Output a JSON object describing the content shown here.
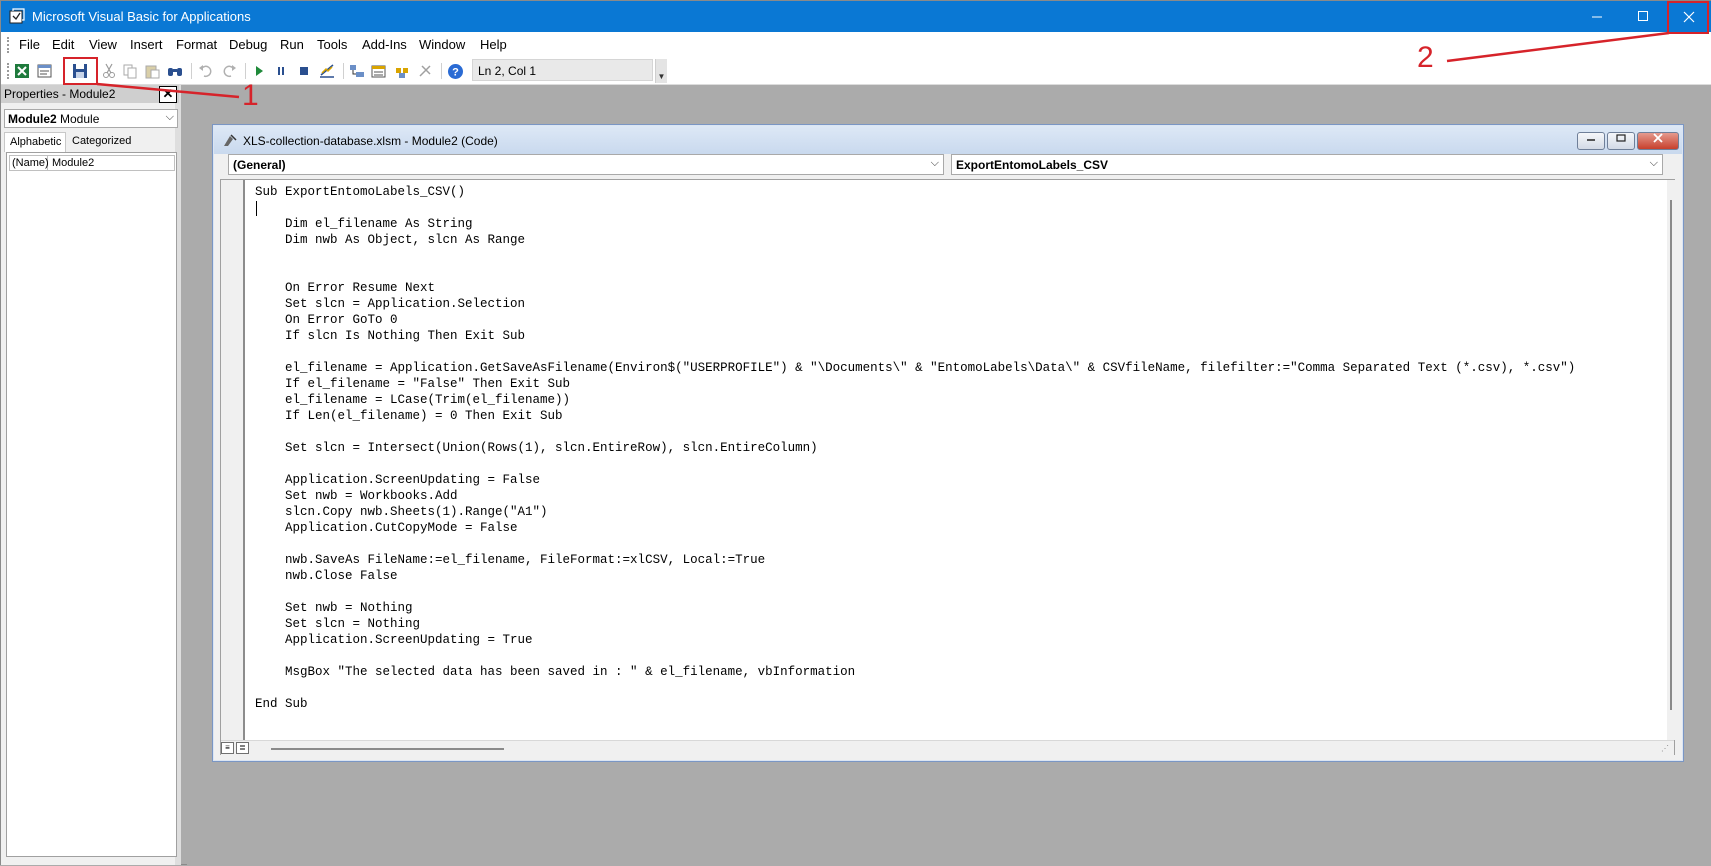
{
  "window": {
    "title": "Microsoft Visual Basic for Applications",
    "minimize_icon": "minimize-icon",
    "maximize_icon": "maximize-icon",
    "close_icon": "close-icon"
  },
  "menu": {
    "items": [
      "File",
      "Edit",
      "View",
      "Insert",
      "Format",
      "Debug",
      "Run",
      "Tools",
      "Add-Ins",
      "Window",
      "Help"
    ]
  },
  "toolbar": {
    "status": "Ln 2, Col 1",
    "icons": [
      "excel-view-icon",
      "insert-module-icon",
      "save-icon",
      "cut-icon",
      "copy-icon",
      "paste-icon",
      "find-icon",
      "undo-icon",
      "redo-icon",
      "run-icon",
      "break-icon",
      "reset-icon",
      "design-mode-icon",
      "project-explorer-icon",
      "properties-window-icon",
      "object-browser-icon",
      "toolbox-icon",
      "help-icon"
    ]
  },
  "properties": {
    "title": "Properties - Module2",
    "object_name": "Module2",
    "object_type": "Module",
    "tabs": [
      "Alphabetic",
      "Categorized"
    ],
    "rows": [
      {
        "name": "(Name)",
        "value": "Module2"
      }
    ]
  },
  "code_window": {
    "title": "XLS-collection-database.xlsm - Module2 (Code)",
    "object_combo": "(General)",
    "procedure_combo": "ExportEntomoLabels_CSV",
    "lines": [
      "Sub ExportEntomoLabels_CSV()",
      "",
      "    Dim el_filename As String",
      "    Dim nwb As Object, slcn As Range",
      "",
      "",
      "    On Error Resume Next",
      "    Set slcn = Application.Selection",
      "    On Error GoTo 0",
      "    If slcn Is Nothing Then Exit Sub",
      "",
      "    el_filename = Application.GetSaveAsFilename(Environ$(\"USERPROFILE\") & \"\\Documents\\\" & \"EntomoLabels\\Data\\\" & CSVfileName, filefilter:=\"Comma Separated Text (*.csv), *.csv\")",
      "    If el_filename = \"False\" Then Exit Sub",
      "    el_filename = LCase(Trim(el_filename))",
      "    If Len(el_filename) = 0 Then Exit Sub",
      "",
      "    Set slcn = Intersect(Union(Rows(1), slcn.EntireRow), slcn.EntireColumn)",
      "",
      "    Application.ScreenUpdating = False",
      "    Set nwb = Workbooks.Add",
      "    slcn.Copy nwb.Sheets(1).Range(\"A1\")",
      "    Application.CutCopyMode = False",
      "",
      "    nwb.SaveAs FileName:=el_filename, FileFormat:=xlCSV, Local:=True",
      "    nwb.Close False",
      "",
      "    Set nwb = Nothing",
      "    Set slcn = Nothing",
      "    Application.ScreenUpdating = True",
      "",
      "    MsgBox \"The selected data has been saved in : \" & el_filename, vbInformation",
      "",
      "End Sub"
    ]
  },
  "annotations": {
    "label_1": "1",
    "label_2": "2",
    "color": "#d6232a"
  }
}
